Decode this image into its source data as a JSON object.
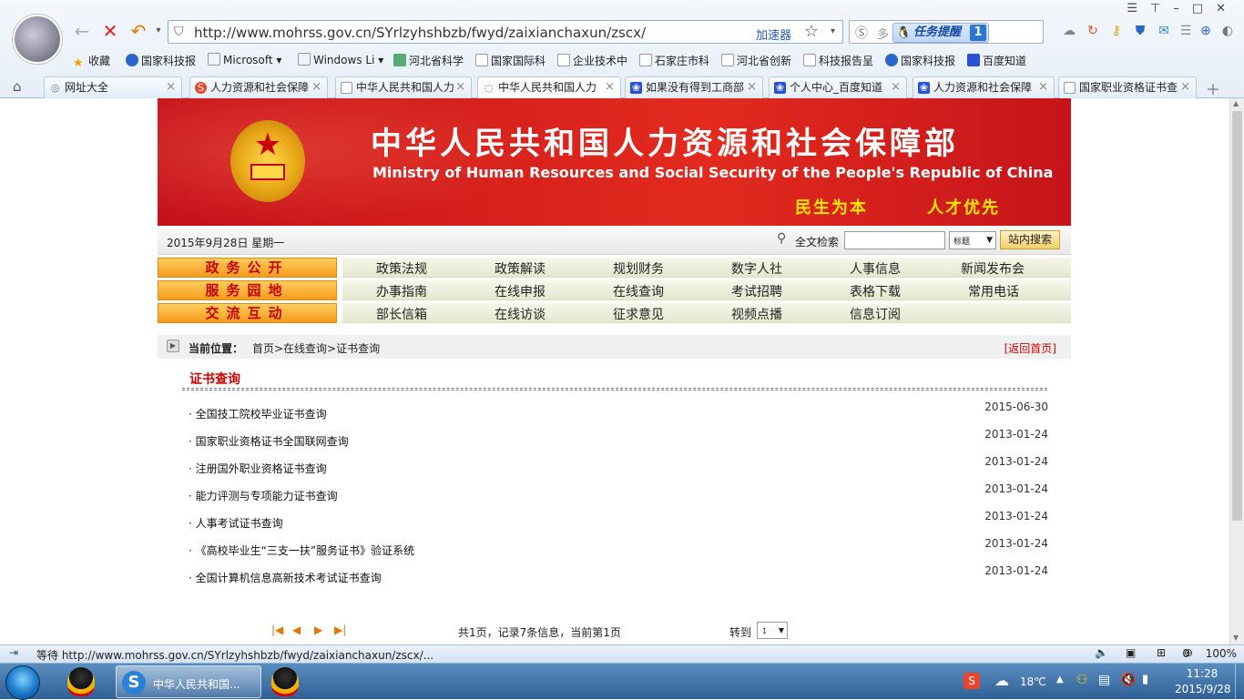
{
  "browser": {
    "url": "http://www.mohrss.gov.cn/SYrlzyhshbzb/fwyd/zaixianchaxun/zscx/",
    "accelerator": "加速器",
    "task_reminder": "任务提醒",
    "task_count": "1",
    "search_placeholder": "多"
  },
  "favorites": [
    {
      "label": "收藏"
    },
    {
      "label": "国家科技报"
    },
    {
      "label": "Microsoft"
    },
    {
      "label": "Windows Li"
    },
    {
      "label": "河北省科学"
    },
    {
      "label": "国家国际科"
    },
    {
      "label": "企业技术中"
    },
    {
      "label": "石家庄市科"
    },
    {
      "label": "河北省创新"
    },
    {
      "label": "科技报告呈"
    },
    {
      "label": "国家科技报"
    },
    {
      "label": "百度知道"
    }
  ],
  "tabs": [
    {
      "label": "网址大全"
    },
    {
      "label": "人力资源和社会保障"
    },
    {
      "label": "中华人民共和国人力"
    },
    {
      "label": "中华人民共和国人力"
    },
    {
      "label": "如果没有得到工商部"
    },
    {
      "label": "个人中心_百度知道"
    },
    {
      "label": "人力资源和社会保障"
    },
    {
      "label": "国家职业资格证书查"
    }
  ],
  "banner": {
    "title": "中华人民共和国人力资源和社会保障部",
    "subtitle": "Ministry of Human Resources and Social Security of the People's Republic of China",
    "slogan1": "民生为本",
    "slogan2": "人才优先"
  },
  "datebar": {
    "date": "2015年9月28日  星期一",
    "fulltext_label": "全文检索",
    "select_value": "标题",
    "search_button": "站内搜索"
  },
  "menu": {
    "categories": [
      "政务公开",
      "服务园地",
      "交流互动"
    ],
    "row1": [
      "政策法规",
      "政策解读",
      "规划财务",
      "数字人社",
      "人事信息",
      "新闻发布会"
    ],
    "row2": [
      "办事指南",
      "在线申报",
      "在线查询",
      "考试招聘",
      "表格下载",
      "常用电话"
    ],
    "row3": [
      "部长信箱",
      "在线访谈",
      "征求意见",
      "视频点播",
      "信息订阅"
    ]
  },
  "breadcrumb": {
    "label": "当前位置：",
    "path": "首页>在线查询>证书查询",
    "home_link": "[返回首页]"
  },
  "section_title": "证书查询",
  "items": [
    {
      "title": "· 全国技工院校毕业证书查询",
      "date": "2015-06-30"
    },
    {
      "title": "· 国家职业资格证书全国联网查询",
      "date": "2013-01-24"
    },
    {
      "title": "· 注册国外职业资格证书查询",
      "date": "2013-01-24"
    },
    {
      "title": "· 能力评测与专项能力证书查询",
      "date": "2013-01-24"
    },
    {
      "title": "· 人事考试证书查询",
      "date": "2013-01-24"
    },
    {
      "title": "· 《高校毕业生“三支一扶”服务证书》验证系统",
      "date": "2013-01-24"
    },
    {
      "title": "· 全国计算机信息高新技术考试证书查询",
      "date": "2013-01-24"
    }
  ],
  "pager": {
    "info": "共1页，记录7条信息，当前第1页",
    "goto_label": "转到",
    "page_value": "1"
  },
  "status": {
    "text": "等待 http://www.mohrss.gov.cn/SYrlzyhshbzb/fwyd/zaixianchaxun/zscx/...",
    "blocked": "0",
    "zoom": "100%"
  },
  "taskbar": {
    "active_window": "中华人民共和国...",
    "temperature": "18℃",
    "time": "11:28",
    "date": "2015/9/28"
  },
  "colors": {
    "banner_red": "#d6201c",
    "menu_orange": "#f49b1c",
    "title_red": "#d10000",
    "slogan_yellow": "#ffe600"
  }
}
